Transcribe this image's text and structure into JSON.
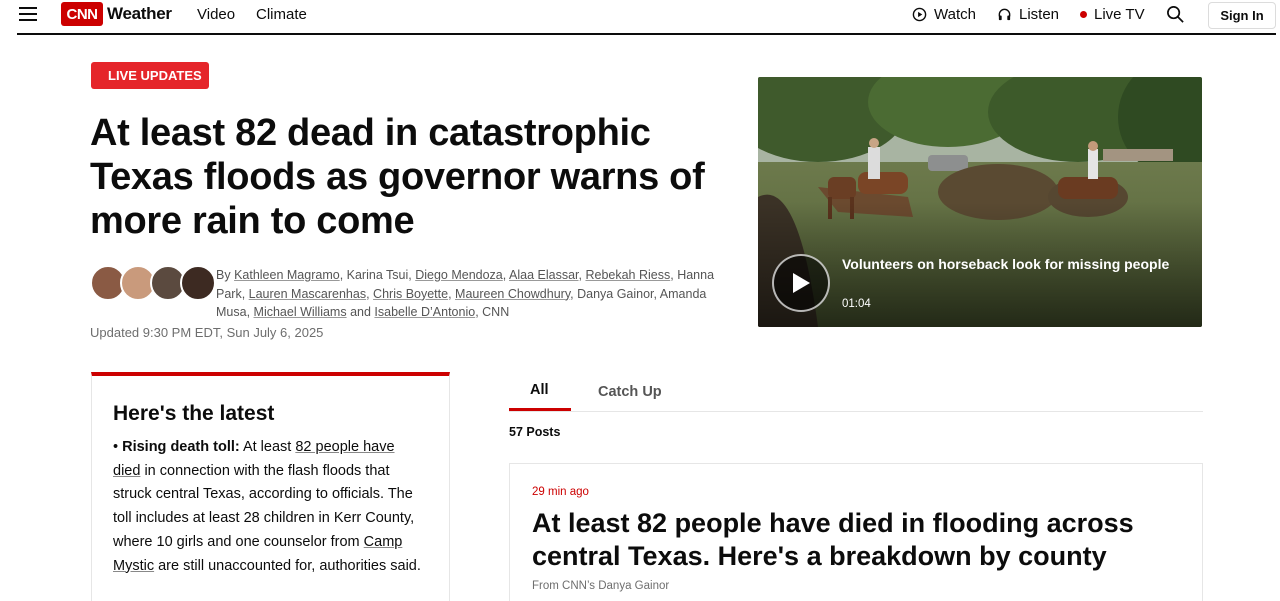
{
  "header": {
    "brand_mark": "CNN",
    "section": "Weather",
    "nav": [
      "Video",
      "Climate"
    ],
    "watch_label": "Watch",
    "listen_label": "Listen",
    "live_tv_label": "Live TV",
    "signin_label": "Sign In"
  },
  "hero": {
    "badge": "LIVE UPDATES",
    "headline": "At least 82 dead in catastrophic Texas floods as governor warns of more rain to come",
    "byline": {
      "prefix": "By ",
      "authors": [
        {
          "name": "Kathleen Magramo",
          "link": true
        },
        {
          "name": "Karina Tsui",
          "link": false
        },
        {
          "name": "Diego Mendoza",
          "link": true
        },
        {
          "name": "Alaa Elassar",
          "link": true
        },
        {
          "name": "Rebekah Riess",
          "link": true
        },
        {
          "name": "Hanna Park",
          "link": false
        },
        {
          "name": "Lauren Mascarenhas",
          "link": true
        },
        {
          "name": "Chris Boyette",
          "link": true
        },
        {
          "name": "Maureen Chowdhury",
          "link": true
        },
        {
          "name": "Danya Gainor",
          "link": false
        },
        {
          "name": "Amanda Musa",
          "link": false
        },
        {
          "name": "Michael Williams",
          "link": true
        },
        {
          "name": "Isabelle D’Antonio",
          "link": true
        }
      ],
      "suffix": ", CNN"
    },
    "updated": "Updated 9:30 PM EDT, Sun July 6, 2025",
    "avatar_colors": [
      "#8a5a44",
      "#c99a7c",
      "#5b4a3f",
      "#3d2a22"
    ]
  },
  "video": {
    "caption": "Volunteers on horseback look for missing people",
    "duration": "01:04"
  },
  "latest": {
    "title": "Here's the latest",
    "bullet_label": "Rising death toll:",
    "text_1": " At least ",
    "link_1": "82 people have died",
    "text_2": " in connection with the flash floods that struck central Texas, according to officials. The toll includes at least 28 children in Kerr County, where 10 girls and one counselor from ",
    "link_2": "Camp Mystic",
    "text_3": " are still unaccounted for, authorities said."
  },
  "tabs": {
    "all": "All",
    "catch_up": "Catch Up"
  },
  "posts": {
    "count": "57 Posts",
    "first": {
      "time": "29 min ago",
      "title": "At least 82 people have died in flooding across central Texas. Here's a breakdown by county",
      "from": "From CNN’s Danya Gainor"
    }
  },
  "colors": {
    "brand_red": "#cc0000",
    "badge_red": "#e5252a"
  }
}
